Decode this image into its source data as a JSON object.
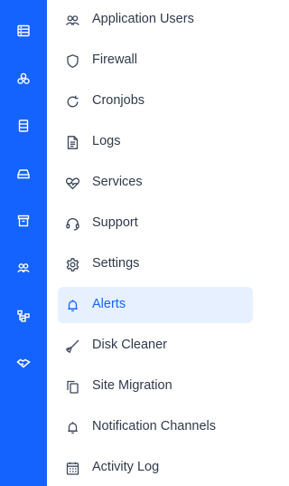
{
  "colors": {
    "rail_bg": "#1563ff",
    "rail_icon": "#ffffff",
    "text": "#2f3a4b",
    "active_text": "#1563ff",
    "active_bg": "#e6f0ff"
  },
  "rail": {
    "items": [
      {
        "icon": "server-icon"
      },
      {
        "icon": "cubes-icon"
      },
      {
        "icon": "database-icon"
      },
      {
        "icon": "drive-icon"
      },
      {
        "icon": "archive-icon"
      },
      {
        "icon": "users-icon"
      },
      {
        "icon": "network-icon"
      },
      {
        "icon": "handshake-icon"
      }
    ]
  },
  "menu": {
    "active_index": 7,
    "items": [
      {
        "label": "Application Users",
        "icon": "users-icon"
      },
      {
        "label": "Firewall",
        "icon": "shield-icon"
      },
      {
        "label": "Cronjobs",
        "icon": "refresh-icon"
      },
      {
        "label": "Logs",
        "icon": "document-icon"
      },
      {
        "label": "Services",
        "icon": "heartbeat-icon"
      },
      {
        "label": "Support",
        "icon": "headset-icon"
      },
      {
        "label": "Settings",
        "icon": "gear-icon"
      },
      {
        "label": "Alerts",
        "icon": "bell-icon"
      },
      {
        "label": "Disk Cleaner",
        "icon": "broom-icon"
      },
      {
        "label": "Site Migration",
        "icon": "copy-icon"
      },
      {
        "label": "Notification Channels",
        "icon": "bell-icon"
      },
      {
        "label": "Activity Log",
        "icon": "calendar-icon"
      }
    ]
  }
}
